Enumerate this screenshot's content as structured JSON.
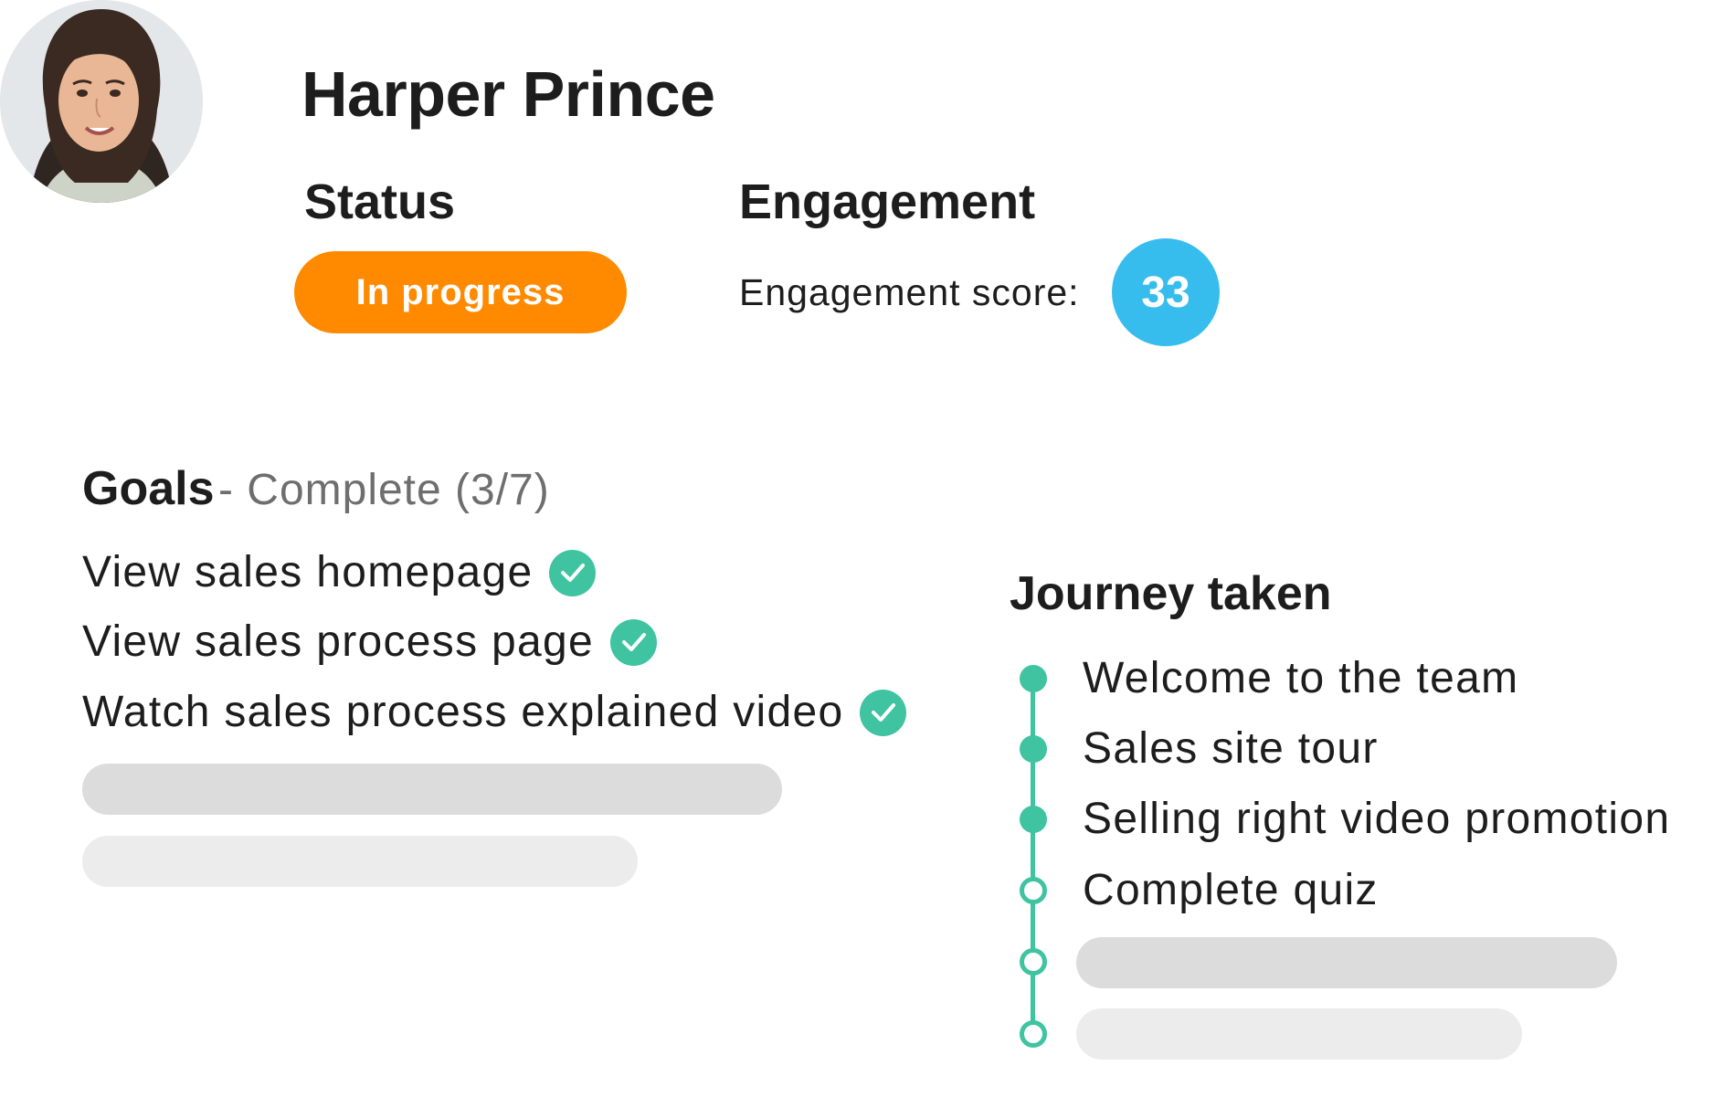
{
  "profile": {
    "name": "Harper Prince",
    "avatar_icon": "user-avatar-photo"
  },
  "status": {
    "heading": "Status",
    "value": "In progress",
    "color": "#FF8A00"
  },
  "engagement": {
    "heading": "Engagement",
    "score_label": "Engagement score:",
    "score": "33",
    "color": "#36BDED"
  },
  "goals": {
    "title": "Goals",
    "subtitle": "- Complete (3/7)",
    "completed_count": 3,
    "total_count": 7,
    "items": [
      {
        "label": "View sales homepage",
        "done": true
      },
      {
        "label": "View sales process page",
        "done": true
      },
      {
        "label": "Watch sales process explained video",
        "done": true
      }
    ],
    "check_icon": "check-circle-icon",
    "check_color": "#3FC3A1"
  },
  "journey": {
    "title": "Journey taken",
    "steps": [
      {
        "label": "Welcome to the team",
        "completed": true
      },
      {
        "label": "Sales site tour",
        "completed": true
      },
      {
        "label": "Selling right video promotion",
        "completed": true
      },
      {
        "label": "Complete quiz",
        "completed": false
      }
    ],
    "accent_color": "#3FC3A1"
  }
}
